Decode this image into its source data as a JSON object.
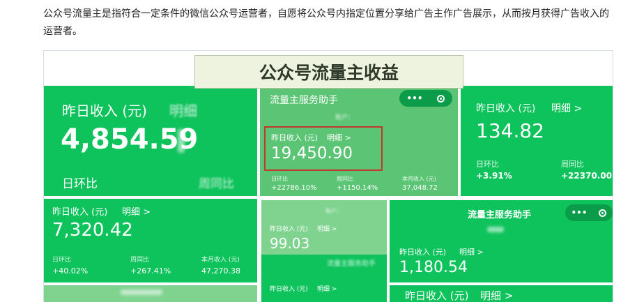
{
  "article": {
    "text": "公众号流量主是指符合一定条件的微信公众号运营者，自愿将公众号内指定位置分享给广告主作广告展示，从而按月获得广告收入的运营者。"
  },
  "image": {
    "banner_title": "公众号流量主收益",
    "card1": {
      "label": "昨日收入 (元)",
      "detail": "明细",
      "value": "4,854.59",
      "ratio_label": "日环比",
      "ratio2_label": "周同比"
    },
    "card2": {
      "title": "流量主服务助手",
      "menu": "•••",
      "account": "账户：",
      "label": "昨日收入 (元)",
      "detail": "明细 >",
      "value": "19,450.90",
      "stats": [
        {
          "label": "日环比",
          "value": "+22786.10%"
        },
        {
          "label": "周同比",
          "value": "+1150.14%"
        },
        {
          "label": "本月收入 (元)",
          "value": "37,048.72"
        }
      ]
    },
    "card3": {
      "label": "昨日收入 (元)",
      "detail": "明细 >",
      "value": "134.82",
      "stats": [
        {
          "label": "日环比",
          "value": "+3.91%"
        },
        {
          "label": "周同比",
          "value": "+22370.00"
        }
      ]
    },
    "card4": {
      "label": "昨日收入 (元)",
      "detail": "明细 >",
      "value": "7,320.42",
      "stats": [
        {
          "label": "日环比",
          "value": "+40.02%"
        },
        {
          "label": "周同比",
          "value": "+267.41%"
        },
        {
          "label": "本月收入 (元)",
          "value": "47,270.38"
        }
      ]
    },
    "card5": {
      "account": "账户：",
      "label": "昨日收入 (元)",
      "detail": "明细 >",
      "value": "99.03",
      "title": "流量主服务助手",
      "label2": "昨日收入 (元)",
      "detail2": "明细 >"
    },
    "card6": {
      "title": "流量主服务助手",
      "menu": "•••",
      "label": "昨日收入 (元)",
      "detail": "明细 >",
      "value": "1,180.54"
    },
    "card7": {
      "label": "昨日收入 (元)",
      "detail": "明细 >"
    },
    "colors": {
      "green": "#0fc35c",
      "highlight": "#c0392b"
    }
  }
}
